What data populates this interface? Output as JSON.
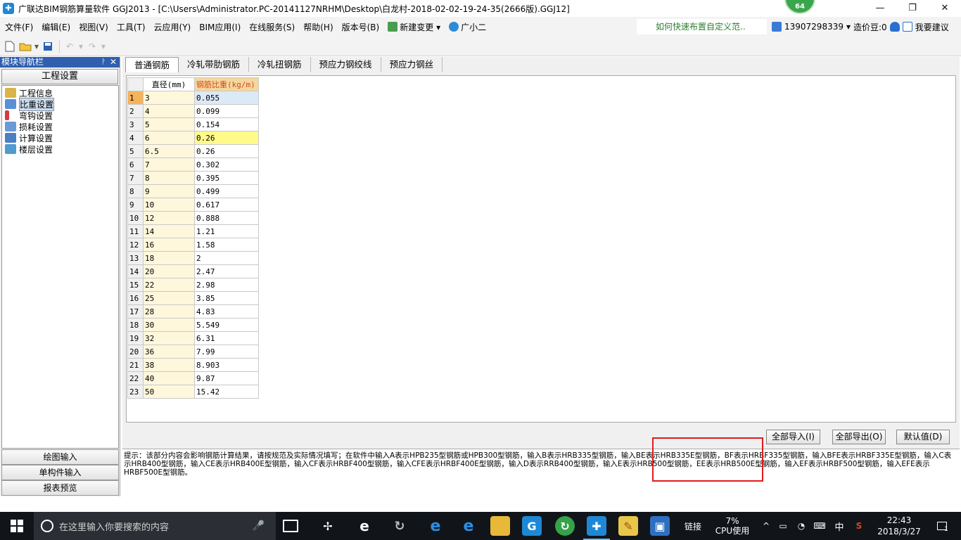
{
  "window": {
    "title": "广联达BIM钢筋算量软件 GGJ2013 - [C:\\Users\\Administrator.PC-20141127NRHM\\Desktop\\白龙村-2018-02-02-19-24-35(2666版).GGJ12]",
    "badge": "64",
    "minimize": "—",
    "restore": "❐",
    "close": "✕"
  },
  "menubar": {
    "items": [
      "文件(F)",
      "编辑(E)",
      "视图(V)",
      "工具(T)",
      "云应用(Y)",
      "BIM应用(I)",
      "在线服务(S)",
      "帮助(H)",
      "版本号(B)"
    ],
    "new_change": "新建变更",
    "new_change_arrow": "▾",
    "assistant": "广小二",
    "tip_link": "如何快速布置自定义范..",
    "phone": "13907298339",
    "phone_arrow": "▾",
    "cost_beans": "造价豆:0",
    "suggest": "我要建议"
  },
  "leftnav": {
    "title": "模块导航栏",
    "pin": "ᚹ",
    "close": "✕",
    "section": "工程设置",
    "items": [
      "工程信息",
      "比重设置",
      "弯钩设置",
      "损耗设置",
      "计算设置",
      "楼层设置"
    ],
    "bottom": [
      "绘图输入",
      "单构件输入",
      "报表预览"
    ]
  },
  "tabs": [
    "普通钢筋",
    "冷轧带肋钢筋",
    "冷轧扭钢筋",
    "预应力钢绞线",
    "预应力钢丝"
  ],
  "grid": {
    "headers": [
      "直径(mm)",
      "钢筋比重(kg/m)"
    ],
    "rows": [
      [
        "1",
        "3",
        "0.055"
      ],
      [
        "2",
        "4",
        "0.099"
      ],
      [
        "3",
        "5",
        "0.154"
      ],
      [
        "4",
        "6",
        "0.26"
      ],
      [
        "5",
        "6.5",
        "0.26"
      ],
      [
        "6",
        "7",
        "0.302"
      ],
      [
        "7",
        "8",
        "0.395"
      ],
      [
        "8",
        "9",
        "0.499"
      ],
      [
        "9",
        "10",
        "0.617"
      ],
      [
        "10",
        "12",
        "0.888"
      ],
      [
        "11",
        "14",
        "1.21"
      ],
      [
        "12",
        "16",
        "1.58"
      ],
      [
        "13",
        "18",
        "2"
      ],
      [
        "14",
        "20",
        "2.47"
      ],
      [
        "15",
        "22",
        "2.98"
      ],
      [
        "16",
        "25",
        "3.85"
      ],
      [
        "17",
        "28",
        "4.83"
      ],
      [
        "18",
        "30",
        "5.549"
      ],
      [
        "19",
        "32",
        "6.31"
      ],
      [
        "20",
        "36",
        "7.99"
      ],
      [
        "21",
        "38",
        "8.903"
      ],
      [
        "22",
        "40",
        "9.87"
      ],
      [
        "23",
        "50",
        "15.42"
      ]
    ]
  },
  "buttons": {
    "import_all": "全部导入(I)",
    "export_all": "全部导出(O)",
    "default": "默认值(D)"
  },
  "hint": "提示：该部分内容会影响钢筋计算结果，请按规范及实际情况填写；在软件中输入A表示HPB235型钢筋或HPB300型钢筋，输入B表示HRB335型钢筋，输入BE表示HRB335E型钢筋，BF表示HRBF335型钢筋，输入BFE表示HRBF335E型钢筋，输入C表示HRB400型钢筋，输入CE表示HRB400E型钢筋，输入CF表示HRBF400型钢筋，输入CFE表示HRBF400E型钢筋，输入D表示RRB400型钢筋，输入E表示HRB500型钢筋，EE表示HRB500E型钢筋，输入EF表示HRBF500型钢筋，输入EFE表示HRBF500E型钢筋。",
  "taskbar": {
    "search_placeholder": "在这里输入你要搜索的内容",
    "mic": "🎤",
    "link_label": "链接",
    "cpu_percent": "7%",
    "cpu_label": "CPU使用",
    "ime": "中",
    "time": "22:43",
    "date": "2018/3/27",
    "notification_count": "1"
  }
}
